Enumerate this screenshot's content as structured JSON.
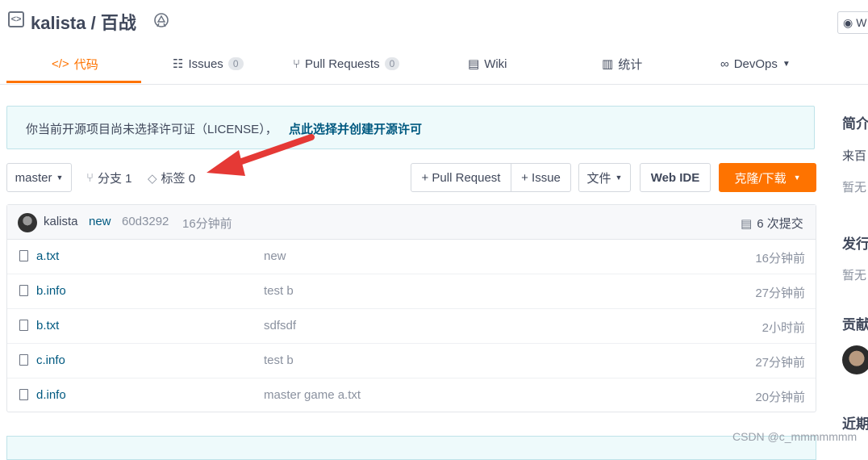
{
  "repo": {
    "owner": "kalista",
    "separator": "/",
    "name": "百战",
    "title": "kalista / 百战"
  },
  "watch": {
    "label": "W"
  },
  "tabs": [
    {
      "icon": "code-icon",
      "label": "代码",
      "active": true
    },
    {
      "icon": "issues-icon",
      "label": "Issues",
      "count": "0"
    },
    {
      "icon": "pull-request-icon",
      "label": "Pull Requests",
      "count": "0"
    },
    {
      "icon": "wiki-icon",
      "label": "Wiki"
    },
    {
      "icon": "stats-icon",
      "label": "统计"
    },
    {
      "icon": "devops-icon",
      "label": "DevOps"
    }
  ],
  "notice": {
    "text": "你当前开源项目尚未选择许可证（LICENSE），",
    "link": "点此选择并创建开源许可"
  },
  "toolbar": {
    "branch": "master",
    "branches": "分支 1",
    "tags": "标签 0",
    "pull_request": "+ Pull Request",
    "issue": "+ Issue",
    "file": "文件",
    "web_ide": "Web IDE",
    "clone": "克隆/下载"
  },
  "commit": {
    "author": "kalista",
    "message": "new",
    "hash": "60d3292",
    "time": "16分钟前",
    "count": "6 次提交"
  },
  "files": [
    {
      "name": "a.txt",
      "message": "new",
      "time": "16分钟前"
    },
    {
      "name": "b.info",
      "message": "test b",
      "time": "27分钟前"
    },
    {
      "name": "b.txt",
      "message": "sdfsdf",
      "time": "2小时前"
    },
    {
      "name": "c.info",
      "message": "test b",
      "time": "27分钟前"
    },
    {
      "name": "d.info",
      "message": "master game a.txt",
      "time": "20分钟前"
    }
  ],
  "sidebar": {
    "intro_heading": "简介",
    "intro_text": "来百",
    "intro_none": "暂无",
    "release_heading": "发行",
    "release_none": "暂无",
    "contrib_heading": "贡献",
    "recent_heading": "近期"
  },
  "watermark": "CSDN @c_mmmmmmm",
  "colors": {
    "accent": "#fe7300",
    "link": "#005980",
    "arrow": "#e53935"
  }
}
